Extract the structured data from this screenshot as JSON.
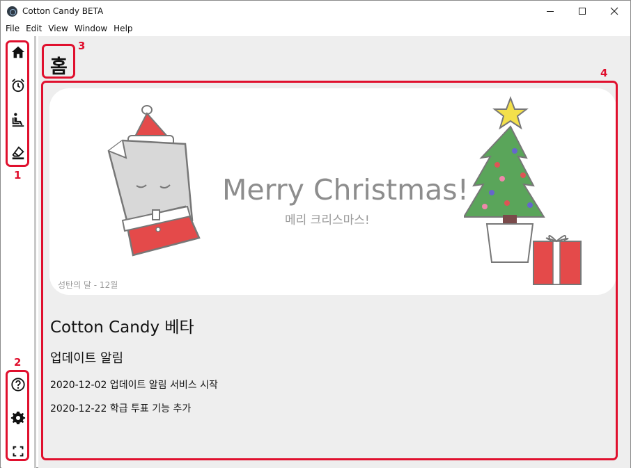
{
  "window": {
    "title": "Cotton Candy BETA"
  },
  "menu": [
    "File",
    "Edit",
    "View",
    "Window",
    "Help"
  ],
  "sidebar": {
    "top_icons": [
      "home-icon",
      "alarm-icon",
      "seat-icon",
      "eraser-icon"
    ],
    "bottom_icons": [
      "help-icon",
      "settings-icon",
      "fullscreen-icon"
    ]
  },
  "page": {
    "title": "홈"
  },
  "banner": {
    "title": "Merry Christmas!",
    "subtitle": "메리 크리스마스!",
    "caption": "성탄의 달  - 12월"
  },
  "main": {
    "heading": "Cotton Candy 베타",
    "subheading": "업데이트 알림",
    "updates": [
      "2020-12-02 업데이트 알림 서비스 시작",
      "2020-12-22 학급 투표 기능 추가"
    ]
  },
  "annotations": {
    "labels": [
      "1",
      "2",
      "3",
      "4"
    ],
    "color": "#e0102e"
  },
  "colors": {
    "main_bg": "#eeeeee",
    "accent": "#e0102e"
  }
}
